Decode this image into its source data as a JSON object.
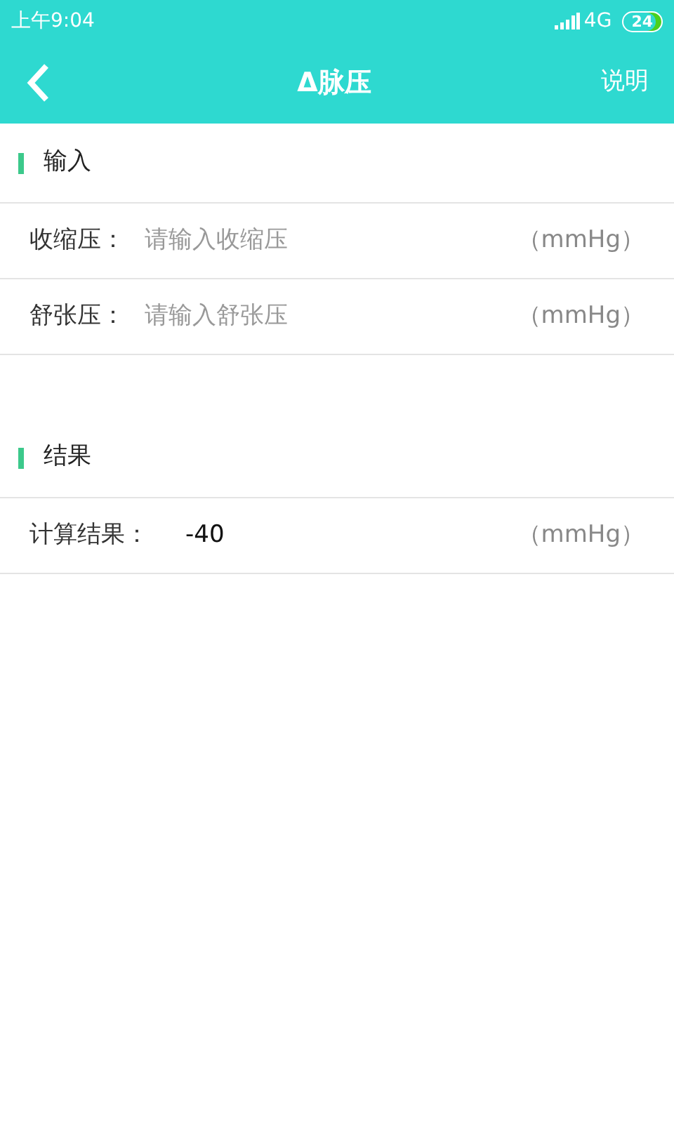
{
  "status_bar": {
    "time": "上午9:04",
    "network": "4G",
    "battery": "24"
  },
  "header": {
    "title": "Δ脉压",
    "action": "说明"
  },
  "sections": [
    {
      "title": "输入",
      "rows": [
        {
          "kind": "input",
          "label": "收缩压：",
          "placeholder": "请输入收缩压",
          "unit": "（mmHg）"
        },
        {
          "kind": "input",
          "label": "舒张压：",
          "placeholder": "请输入舒张压",
          "unit": "（mmHg）"
        }
      ]
    },
    {
      "title": "结果",
      "rows": [
        {
          "kind": "output",
          "label": "计算结果：",
          "value": "-40",
          "unit": "（mmHg）"
        }
      ]
    }
  ]
}
